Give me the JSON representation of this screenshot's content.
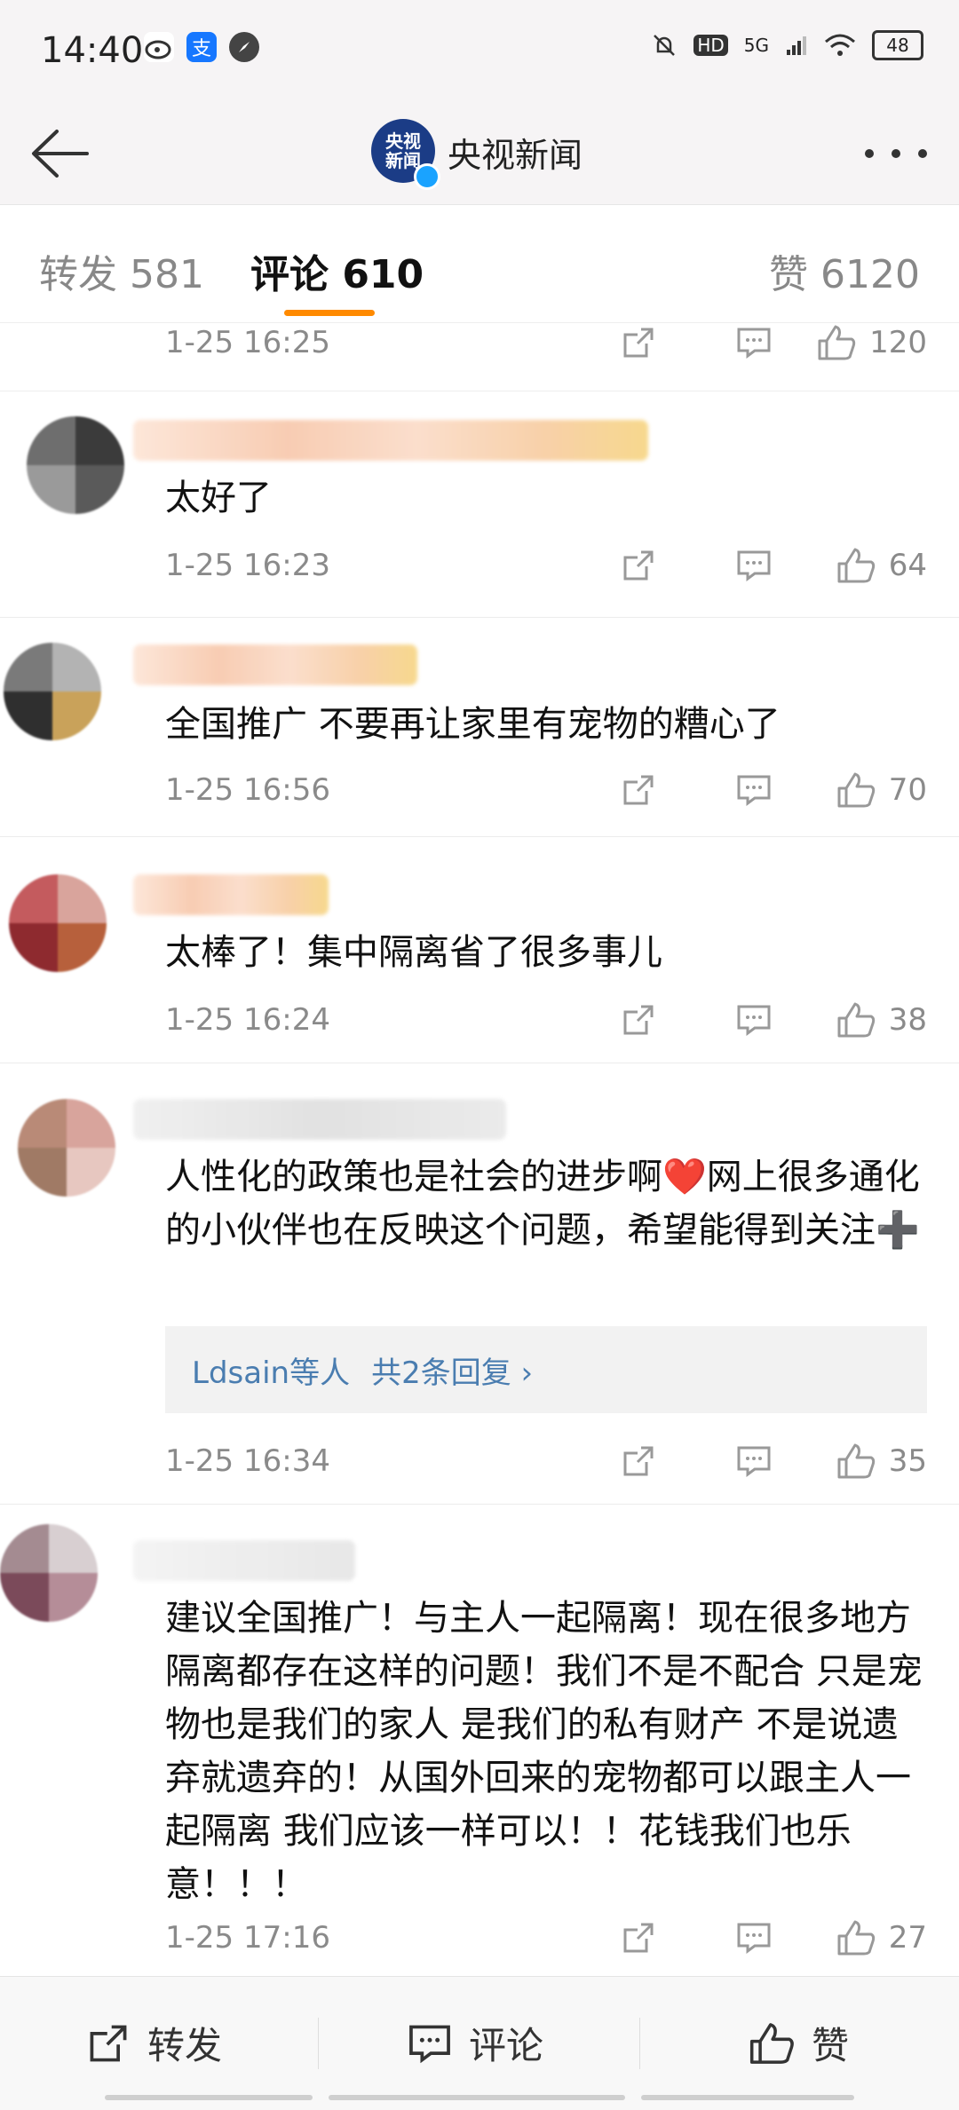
{
  "status": {
    "time": "14:40",
    "battery": "48",
    "network": "5G",
    "hd": "HD"
  },
  "nav": {
    "title": "央视新闻",
    "brand_avatar_text": "央视\n新闻"
  },
  "tabs": [
    {
      "label": "转发 581"
    },
    {
      "label": "评论 610"
    },
    {
      "label": "赞 6120"
    }
  ],
  "partial_comment": {
    "time": "1-25 16:25",
    "likes": "120"
  },
  "comments": [
    {
      "text": "太好了",
      "time": "1-25 16:23",
      "likes": "64"
    },
    {
      "text": "全国推广 不要再让家里有宠物的糟心了",
      "time": "1-25 16:56",
      "likes": "70"
    },
    {
      "text": "太棒了！集中隔离省了很多事儿",
      "time": "1-25 16:24",
      "likes": "38"
    },
    {
      "text": "人性化的政策也是社会的进步啊❤️网上很多通化的小伙伴也在反映这个问题，希望能得到关注➕",
      "time": "1-25 16:34",
      "likes": "35",
      "reply": {
        "users": "Ldsain等人",
        "total": "共2条回复 ›"
      }
    },
    {
      "text": "建议全国推广！与主人一起隔离！现在很多地方隔离都存在这样的问题！我们不是不配合 只是宠物也是我们的家人 是我们的私有财产 不是说遗弃就遗弃的！从国外回来的宠物都可以跟主人一起隔离 我们应该一样可以！！花钱我们也乐意！！！",
      "time": "1-25 17:16",
      "likes": "27"
    }
  ],
  "bottom": {
    "repost": "转发",
    "comment": "评论",
    "like": "赞"
  },
  "colors": {
    "accent": "#ff8a00",
    "link": "#4a7db0",
    "meta": "#8a8a8a"
  }
}
